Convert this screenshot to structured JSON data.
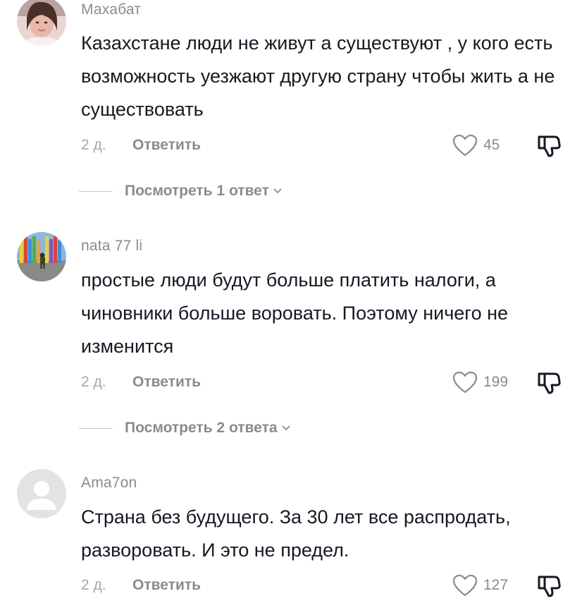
{
  "comments": [
    {
      "username": "Махабат",
      "text": "Казахстане люди не живут а существуют , у кого есть возможность уезжают другую страну чтобы жить а не существовать",
      "time": "2 д.",
      "reply_label": "Ответить",
      "likes": "45",
      "view_replies": "Посмотреть 1 ответ",
      "avatar_icon": "user-photo"
    },
    {
      "username": "nata 77 li",
      "text": "простые люди будут больше платить налоги, а чиновники больше воровать. Поэтому ничего не изменится",
      "time": "2 д.",
      "reply_label": "Ответить",
      "likes": "199",
      "view_replies": "Посмотреть 2 ответа",
      "avatar_icon": "playground-photo"
    },
    {
      "username": "Ama7on",
      "text": "Страна без будущего. За 30 лет все распродать, разворовать. И это не предел.",
      "time": "2 д.",
      "reply_label": "Ответить",
      "likes": "127",
      "avatar_icon": "default-avatar-icon"
    }
  ],
  "icons": {
    "like": "heart-outline-icon",
    "dislike": "thumbs-down-outline-icon",
    "expand": "chevron-down-icon"
  },
  "colors": {
    "text": "#161823",
    "secondary": "#8a8b91",
    "muted": "#a7a8ad"
  }
}
